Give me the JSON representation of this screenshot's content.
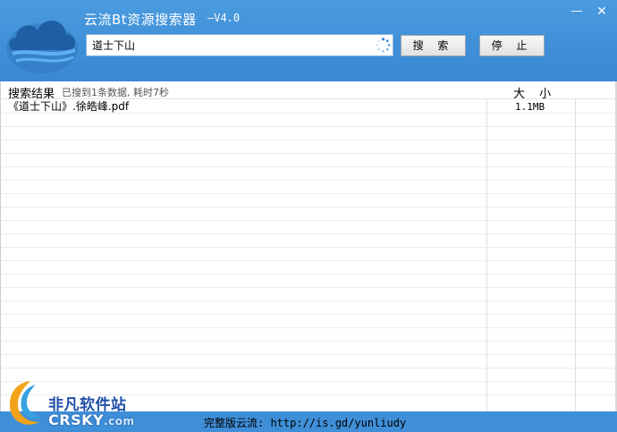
{
  "app": {
    "title": "云流Bt资源搜索器",
    "version": "—V4.0",
    "minimize_glyph": "—",
    "close_glyph": "✕"
  },
  "search": {
    "query": "道士下山",
    "search_label": "搜 索",
    "stop_label": "停 止"
  },
  "results": {
    "header_name": "搜索结果",
    "status": "已搜到1条数据, 耗时7秒",
    "header_size": "大 小",
    "rows": [
      {
        "name": "《道士下山》.徐皓峰.pdf",
        "size": "1.1MB"
      }
    ]
  },
  "footer": {
    "text": "完整版云流: http://is.gd/yunliudy"
  },
  "watermark": {
    "cn": "非凡软件站",
    "en": "CRSKY",
    "domain": ".com"
  },
  "colors": {
    "header_blue": "#3f8fd8",
    "footer_blue": "#3f8fd8"
  },
  "icons": [
    "cloud-logo-icon",
    "loading-spinner-icon",
    "minimize-icon",
    "close-icon",
    "crsky-logo-icon"
  ]
}
